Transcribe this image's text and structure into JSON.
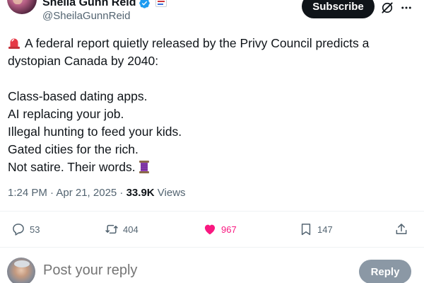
{
  "author": {
    "display_name": "Sheila Gunn Reid",
    "handle": "@SheilaGunnReid"
  },
  "header": {
    "subscribe_label": "Subscribe",
    "grok_icon": "grok-icon",
    "more_icon": "more-icon"
  },
  "tweet": {
    "lines": [
      "A federal report quietly released by the Privy Council predicts a",
      "dystopian Canada by 2040:",
      "Class-based dating apps.",
      "AI replacing your job.",
      "Illegal hunting to feed your kids.",
      "Gated cities for the rich.",
      "Not satire. Their words."
    ],
    "leading_emoji": "siren-icon",
    "trailing_emoji": "thread-icon"
  },
  "meta": {
    "time_date": "1:24 PM · Apr 21, 2025 · ",
    "views_count": "33.9K",
    "views_label": " Views"
  },
  "actions": {
    "replies": "53",
    "reposts": "404",
    "likes": "967",
    "bookmarks": "147"
  },
  "compose": {
    "placeholder": "Post your reply",
    "reply_label": "Reply"
  },
  "colors": {
    "like_pink": "#f91880",
    "verified_blue": "#1d9bf0",
    "text_muted": "#536471"
  }
}
